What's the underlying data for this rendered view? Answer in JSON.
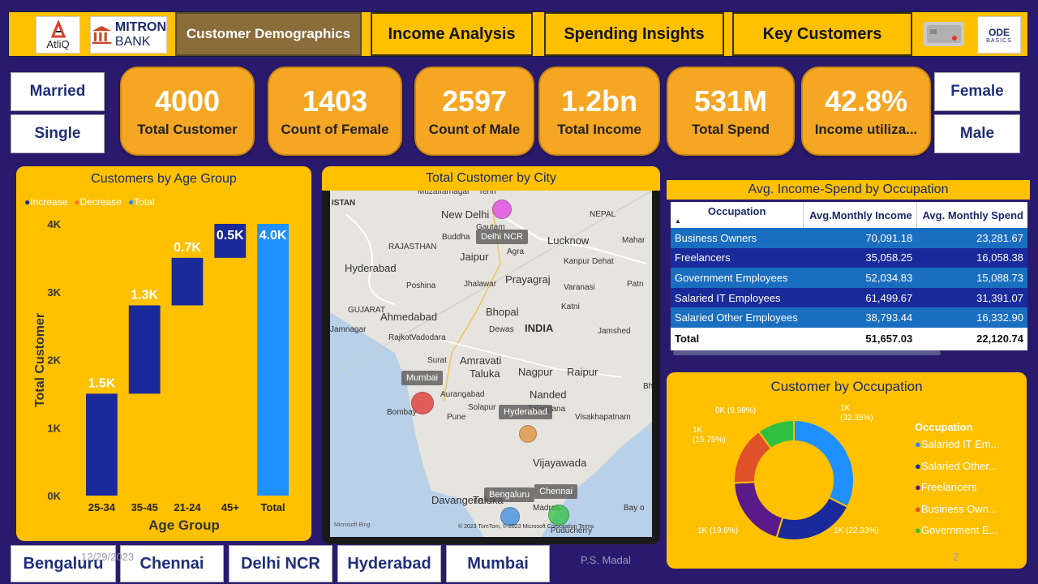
{
  "header": {
    "atliq_label": "AtliQ",
    "mitron_line1": "MITRON",
    "mitron_line2": "BANK",
    "tabs": [
      {
        "label": "Customer Demographics",
        "active": true
      },
      {
        "label": "Income Analysis",
        "active": false
      },
      {
        "label": "Spending Insights",
        "active": false
      },
      {
        "label": "Key Customers",
        "active": false
      }
    ],
    "codebasics_line1": "ODE",
    "codebasics_line2": "BASICS"
  },
  "slicers": {
    "marital": [
      "Married",
      "Single"
    ],
    "gender": [
      "Female",
      "Male"
    ],
    "cities": [
      "Bengaluru",
      "Chennai",
      "Delhi NCR",
      "Hyderabad",
      "Mumbai"
    ]
  },
  "kpis": [
    {
      "value": "4000",
      "label": "Total Customer"
    },
    {
      "value": "1403",
      "label": "Count of Female"
    },
    {
      "value": "2597",
      "label": "Count of Male"
    },
    {
      "value": "1.2bn",
      "label": "Total Income"
    },
    {
      "value": "531M",
      "label": "Total Spend"
    },
    {
      "value": "42.8%",
      "label": "Income utiliza..."
    }
  ],
  "age_chart": {
    "title": "Customers by Age Group",
    "legend": [
      "Increase",
      "Decrease",
      "Total"
    ],
    "legend_colors": [
      "#1a2a9a",
      "#f07a2a",
      "#1e90ff"
    ],
    "ylabel": "Total Customer",
    "xlabel": "Age Group",
    "yticks": [
      "4K",
      "3K",
      "2K",
      "1K",
      "0K"
    ]
  },
  "chart_data": {
    "type": "bar",
    "title": "Customers by Age Group",
    "subtype": "waterfall",
    "categories": [
      "25-34",
      "35-45",
      "21-24",
      "45+",
      "Total"
    ],
    "values": [
      1.5,
      1.3,
      0.7,
      0.5,
      4.0
    ],
    "labels": [
      "1.5K",
      "1.3K",
      "0.7K",
      "0.5K",
      "4.0K"
    ],
    "ylim": [
      0,
      4
    ],
    "xlabel": "Age Group",
    "ylabel": "Total Customer"
  },
  "map": {
    "title": "Total Customer by City",
    "places": [
      "ISTAN",
      "Muzaffarnagar",
      "Tehri",
      "New Delhi",
      "NEPAL",
      "Gautam",
      "Buddha",
      "Lucknow",
      "Mahar",
      "RAJASTHAN",
      "Jaipur",
      "Agra",
      "Kanpur Dehat",
      "Hyderabad",
      "Poshina",
      "Jhalawar",
      "Prayagraj",
      "Varanasi",
      "Patn",
      "GUJARAT",
      "Ahmedabad",
      "Bhopal",
      "Katni",
      "Jamnagar",
      "Rajkot",
      "Vadodara",
      "Dewas",
      "INDIA",
      "Jamshed",
      "Surat",
      "Amravati",
      "Taluka",
      "Nagpur",
      "Raipur",
      "Bhuba",
      "Aurangabad",
      "Nanded",
      "Telangana",
      "Visakhapatnam",
      "Bombay",
      "Pune",
      "Solapur",
      "Vijayawada",
      "Davangere",
      "Taluka",
      "Bay o",
      "Madras",
      "Puducherry"
    ],
    "bubbles": [
      {
        "city": "Delhi NCR",
        "color": "#e040e0"
      },
      {
        "city": "Mumbai",
        "color": "#e03030"
      },
      {
        "city": "Hyderabad",
        "color": "#e0903a"
      },
      {
        "city": "Bengaluru",
        "color": "#3a8ae0"
      },
      {
        "city": "Chennai",
        "color": "#30c040"
      }
    ],
    "copyright": "© 2023 TomTom, © 2023 Microsoft Corporation",
    "terms": "Terms",
    "bing": "Microsoft Bing"
  },
  "occupation_table": {
    "title": "Avg. Income-Spend by Occupation",
    "columns": [
      "Occupation",
      "Avg.Monthly Income",
      "Avg. Monthly Spend"
    ],
    "rows": [
      [
        "Business Owners",
        "70,091.18",
        "23,281.67"
      ],
      [
        "Freelancers",
        "35,058.25",
        "16,058.38"
      ],
      [
        "Government Employees",
        "52,034.83",
        "15,088.73"
      ],
      [
        "Salaried IT Employees",
        "61,499.67",
        "31,391.07"
      ],
      [
        "Salaried Other Employees",
        "38,793.44",
        "16,332.90"
      ]
    ],
    "total": [
      "Total",
      "51,657.03",
      "22,120.74"
    ]
  },
  "donut": {
    "title": "Customer by Occupation",
    "legend_title": "Occupation",
    "slices": [
      {
        "name": "Salaried IT Em...",
        "pct": 32.35,
        "label": "1K\n(32.35%)",
        "color": "#1e90ff"
      },
      {
        "name": "Salaried Other...",
        "pct": 22.33,
        "label": "1K (22.33%)",
        "color": "#1a2a9a"
      },
      {
        "name": "Freelancers",
        "pct": 19.6,
        "label": "1K (19.6%)",
        "color": "#5a1a8a"
      },
      {
        "name": "Business Own...",
        "pct": 15.75,
        "label": "1K\n(15.75%)",
        "color": "#e0502a"
      },
      {
        "name": "Government E...",
        "pct": 9.98,
        "label": "0K (9.98%)",
        "color": "#30c040"
      }
    ]
  },
  "footer": {
    "date": "12/29/2023",
    "author": "P.S. Madal",
    "page": "2"
  }
}
